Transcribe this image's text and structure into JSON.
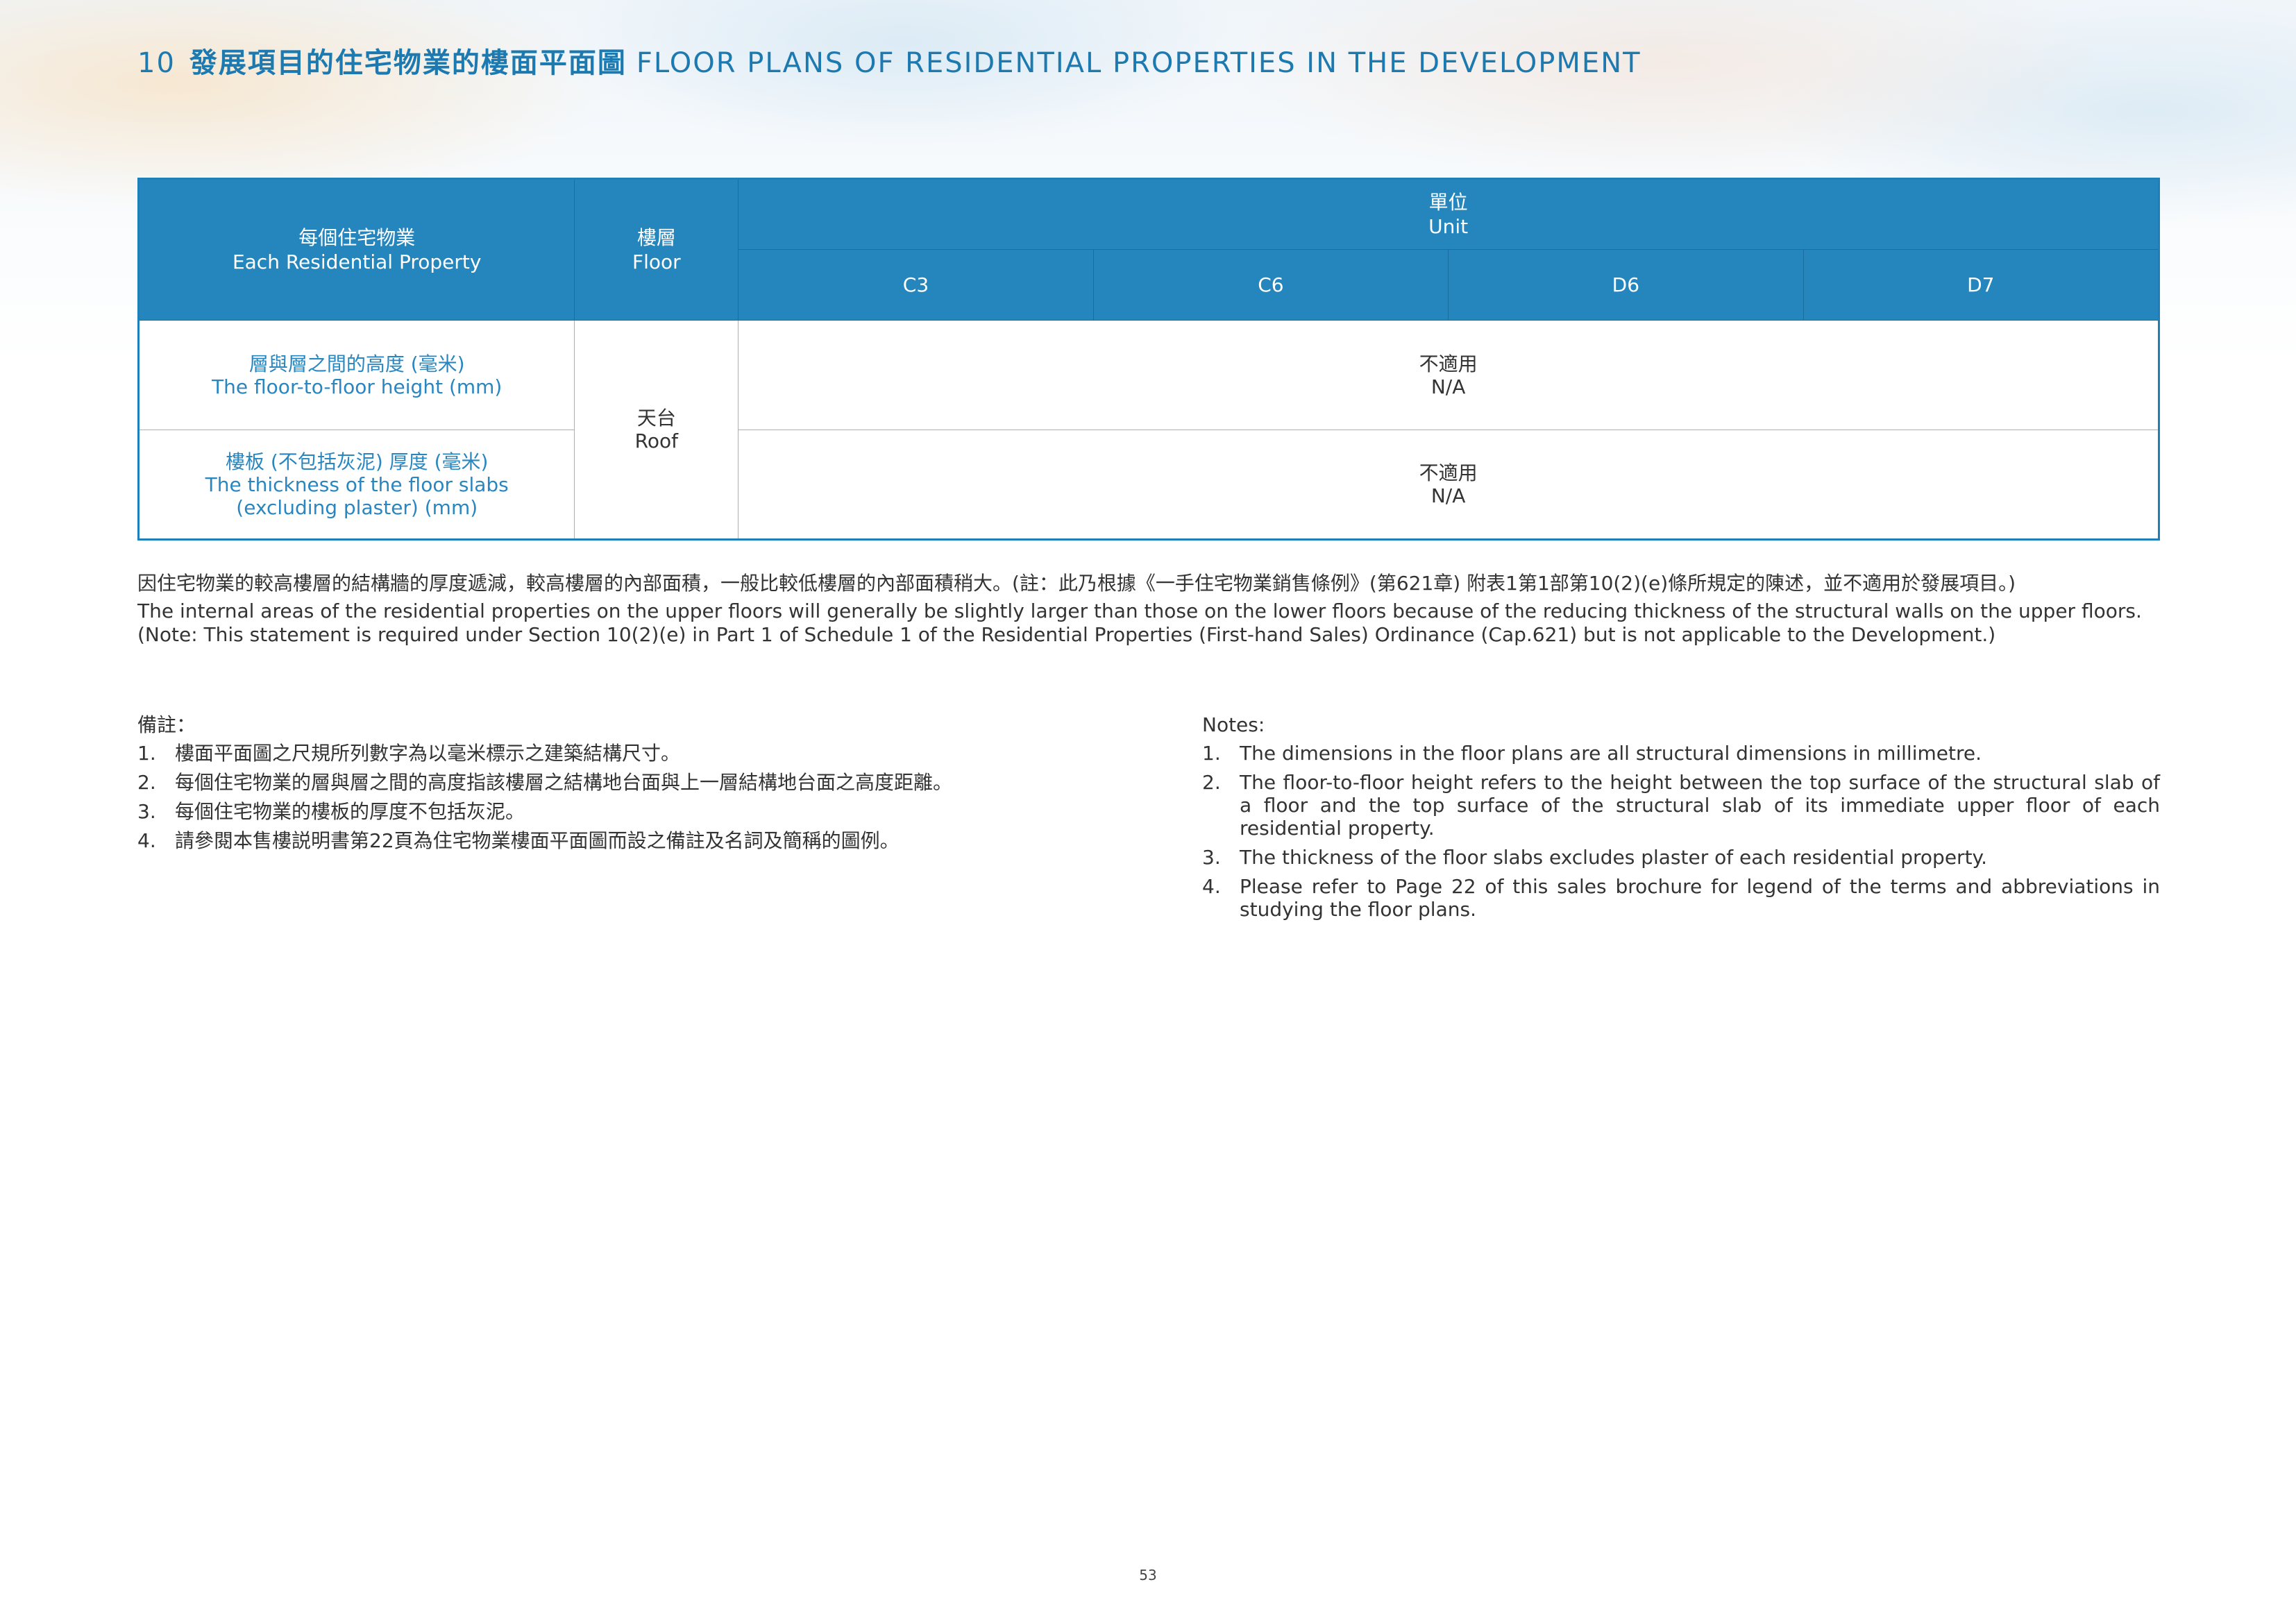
{
  "header": {
    "number": "10",
    "title_zh": "發展項目的住宅物業的樓面平面圖",
    "title_en": "FLOOR PLANS OF RESIDENTIAL PROPERTIES IN THE DEVELOPMENT"
  },
  "table": {
    "col_property_zh": "每個住宅物業",
    "col_property_en": "Each Residential Property",
    "col_floor_zh": "樓層",
    "col_floor_en": "Floor",
    "col_unit_zh": "單位",
    "col_unit_en": "Unit",
    "units": [
      "C3",
      "C6",
      "D6",
      "D7"
    ],
    "floor_zh": "天台",
    "floor_en": "Roof",
    "rows": [
      {
        "label_zh": "層與層之間的高度 (毫米)",
        "label_en": "The floor-to-floor height (mm)",
        "label_en2": "",
        "value_zh": "不適用",
        "value_en": "N/A"
      },
      {
        "label_zh": "樓板 (不包括灰泥) 厚度 (毫米)",
        "label_en": "The thickness of the floor slabs",
        "label_en2": "(excluding plaster) (mm)",
        "value_zh": "不適用",
        "value_en": "N/A"
      }
    ]
  },
  "statement": {
    "zh": "因住宅物業的較高樓層的結構牆的厚度遞減，較高樓層的內部面積，一般比較低樓層的內部面積稍大。(註：此乃根據《一手住宅物業銷售條例》(第621章) 附表1第1部第10(2)(e)條所規定的陳述，並不適用於發展項目。)",
    "en": "The internal areas of the residential properties on the upper floors will generally be slightly larger than those on the lower floors because of the reducing thickness of the structural walls on the upper floors. (Note: This statement is required under Section 10(2)(e) in Part 1 of Schedule 1 of the Residential Properties (First-hand Sales) Ordinance (Cap.621) but is not applicable to the Development.)"
  },
  "notes_zh": {
    "heading": "備註：",
    "items": [
      {
        "num": "1.",
        "text": "樓面平面圖之尺規所列數字為以毫米標示之建築結構尺寸。"
      },
      {
        "num": "2.",
        "text": "每個住宅物業的層與層之間的高度指該樓層之結構地台面與上一層結構地台面之高度距離。"
      },
      {
        "num": "3.",
        "text": "每個住宅物業的樓板的厚度不包括灰泥。"
      },
      {
        "num": "4.",
        "text": "請參閱本售樓説明書第22頁為住宅物業樓面平面圖而設之備註及名詞及簡稱的圖例。"
      }
    ]
  },
  "notes_en": {
    "heading": "Notes:",
    "items": [
      {
        "num": "1.",
        "text": "The dimensions in the floor plans are all structural dimensions in millimetre."
      },
      {
        "num": "2.",
        "text": "The floor-to-floor height refers to the height between the top surface of the structural slab of a floor and the top surface of the structural slab of its immediate upper floor of each residential property."
      },
      {
        "num": "3.",
        "text": "The thickness of the floor slabs excludes plaster of each residential property."
      },
      {
        "num": "4.",
        "text": "Please refer to Page 22 of this sales brochure for legend of the terms and abbreviations in studying the floor plans."
      }
    ]
  },
  "footer": {
    "page_number": "53"
  }
}
